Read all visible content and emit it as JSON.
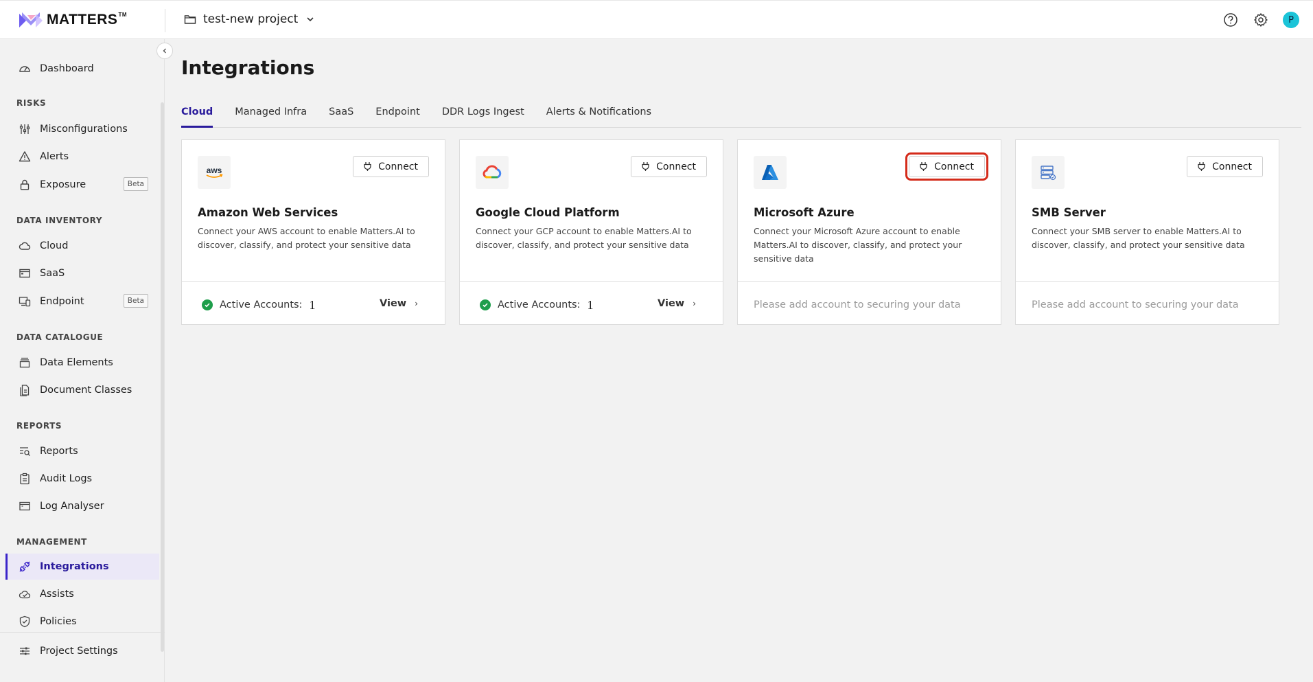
{
  "app": {
    "logo_text": "MATTERS",
    "logo_tm": "TM"
  },
  "header": {
    "project_name": "test-new project",
    "avatar_initial": "P"
  },
  "sidebar": {
    "items": [
      {
        "label": "Dashboard"
      },
      {
        "section": "RISKS"
      },
      {
        "label": "Misconfigurations"
      },
      {
        "label": "Alerts"
      },
      {
        "label": "Exposure",
        "badge": "Beta"
      },
      {
        "section": "DATA INVENTORY"
      },
      {
        "label": "Cloud"
      },
      {
        "label": "SaaS"
      },
      {
        "label": "Endpoint",
        "badge": "Beta"
      },
      {
        "section": "DATA CATALOGUE"
      },
      {
        "label": "Data Elements"
      },
      {
        "label": "Document Classes"
      },
      {
        "section": "REPORTS"
      },
      {
        "label": "Reports"
      },
      {
        "label": "Audit Logs"
      },
      {
        "label": "Log Analyser"
      },
      {
        "section": "MANAGEMENT"
      },
      {
        "label": "Integrations",
        "active": true
      },
      {
        "label": "Assists"
      },
      {
        "label": "Policies"
      },
      {
        "label": "Project Settings"
      }
    ]
  },
  "main": {
    "title": "Integrations",
    "tabs": [
      {
        "label": "Cloud",
        "active": true
      },
      {
        "label": "Managed Infra"
      },
      {
        "label": "SaaS"
      },
      {
        "label": "Endpoint"
      },
      {
        "label": "DDR Logs Ingest"
      },
      {
        "label": "Alerts & Notifications"
      }
    ],
    "cards": [
      {
        "title": "Amazon Web Services",
        "logo": "aws-logo",
        "description": "Connect your AWS account to enable Matters.AI to discover, classify, and protect your sensitive data",
        "connect_label": "Connect",
        "active_label": "Active Accounts:",
        "active_count": "1",
        "view_label": "View",
        "view_arrow": "›"
      },
      {
        "title": "Google Cloud Platform",
        "logo": "gcp-logo",
        "description": "Connect your GCP account to enable Matters.AI to discover, classify, and protect your sensitive data",
        "connect_label": "Connect",
        "active_label": "Active Accounts:",
        "active_count": "1",
        "view_label": "View",
        "view_arrow": "›"
      },
      {
        "title": "Microsoft Azure",
        "logo": "azure-logo",
        "description": "Connect your Microsoft Azure account to enable Matters.AI to discover, classify, and protect your sensitive data",
        "connect_label": "Connect",
        "highlighted": true,
        "empty_text": "Please add account to securing your data"
      },
      {
        "title": "SMB Server",
        "logo": "smb-server-logo",
        "description": "Connect your SMB server to enable Matters.AI to discover, classify, and protect your sensitive data",
        "connect_label": "Connect",
        "empty_text": "Please add account to securing your data"
      }
    ]
  },
  "colors": {
    "accent": "#2a1b9c",
    "active_bg": "#ebe8f7",
    "success": "#1e9e4b",
    "highlight": "#d42b1a",
    "avatar": "#1bc4d8"
  }
}
